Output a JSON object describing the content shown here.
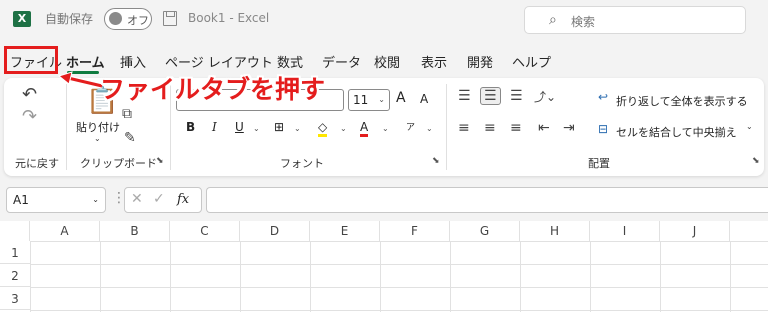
{
  "app": {
    "logo": "X",
    "autosave_label": "自動保存",
    "autosave_state": "オフ",
    "document_title": "Book1  -  Excel",
    "search_placeholder": "検索"
  },
  "tabs": [
    {
      "label": "ファイル"
    },
    {
      "label": "ホーム"
    },
    {
      "label": "挿入"
    },
    {
      "label": "ページ レイアウト"
    },
    {
      "label": "数式"
    },
    {
      "label": "データ"
    },
    {
      "label": "校閲"
    },
    {
      "label": "表示"
    },
    {
      "label": "開発"
    },
    {
      "label": "ヘルプ"
    }
  ],
  "annotation": {
    "text": "ファイルタブを押す",
    "color": "#e41d1d"
  },
  "ribbon": {
    "undo_group_label": "元に戻す",
    "clipboard_group_label": "クリップボード",
    "paste_label": "貼り付け",
    "font_group_label": "フォント",
    "font_size": "11",
    "align_group_label": "配置",
    "wrap_text_label": "折り返して全体を表示する",
    "merge_center_label": "セルを結合して中央揃え",
    "bold": "B",
    "italic": "I",
    "underline": "U",
    "grow_font": "A",
    "shrink_font": "A",
    "font_color": "A"
  },
  "formula_bar": {
    "cell_ref": "A1",
    "fx": "fx"
  },
  "grid": {
    "columns": [
      "A",
      "B",
      "C",
      "D",
      "E",
      "F",
      "G",
      "H",
      "I",
      "J"
    ],
    "rows": [
      "1",
      "2",
      "3"
    ]
  },
  "colors": {
    "accent": "#107c41",
    "annotation": "#e41d1d"
  }
}
